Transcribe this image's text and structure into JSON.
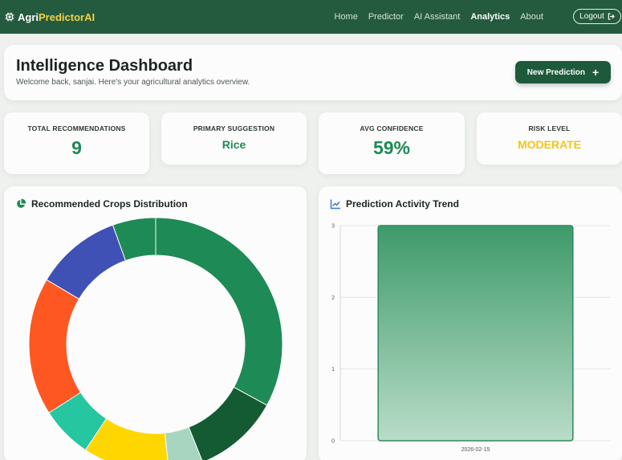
{
  "navbar": {
    "brand_main": "Agri",
    "brand_highlight": "PredictorAI",
    "links": [
      "Home",
      "Predictor",
      "AI Assistant",
      "Analytics",
      "About"
    ],
    "active_link": "Analytics",
    "logout_label": "Logout"
  },
  "header": {
    "title": "Intelligence Dashboard",
    "subtitle": "Welcome back, sanjai. Here's your agricultural analytics overview.",
    "new_prediction_label": "New Prediction",
    "new_prediction_icon": "plus-icon"
  },
  "stats": {
    "total_recommendations": {
      "label": "TOTAL RECOMMENDATIONS",
      "value": "9"
    },
    "primary_suggestion": {
      "label": "PRIMARY SUGGESTION",
      "value": "Rice"
    },
    "avg_confidence": {
      "label": "AVG CONFIDENCE",
      "value": "59%"
    },
    "risk_level": {
      "label": "RISK LEVEL",
      "value": "MODERATE"
    }
  },
  "colors": {
    "primary_green": "#1e8a55",
    "risk_yellow": "#f5c518",
    "nav_bg": "#245b3f"
  },
  "panels": {
    "distribution_title": "Recommended Crops Distribution",
    "distribution_icon": "pie-chart-icon",
    "trend_title": "Prediction Activity Trend",
    "trend_icon": "line-chart-icon"
  },
  "chart_data": [
    {
      "type": "pie",
      "variant": "doughnut",
      "slices": [
        {
          "value": 3,
          "color": "#1e8a55"
        },
        {
          "value": 1,
          "color": "#145a32"
        },
        {
          "value": 0.4,
          "color": "#a8d5bf"
        },
        {
          "value": 1,
          "color": "#ffd600"
        },
        {
          "value": 0.6,
          "color": "#26c6a0"
        },
        {
          "value": 1.6,
          "color": "#ff5722"
        },
        {
          "value": 1,
          "color": "#3f51b5"
        },
        {
          "value": 0.5,
          "color": "#1e8a55"
        }
      ]
    },
    {
      "type": "bar",
      "categories": [
        "2026-02-15"
      ],
      "values": [
        3
      ],
      "ylim": [
        0,
        3
      ],
      "yticks": [
        "0",
        "1",
        "2",
        "3"
      ],
      "grid": true,
      "bar_color": "#4fa77a"
    }
  ]
}
